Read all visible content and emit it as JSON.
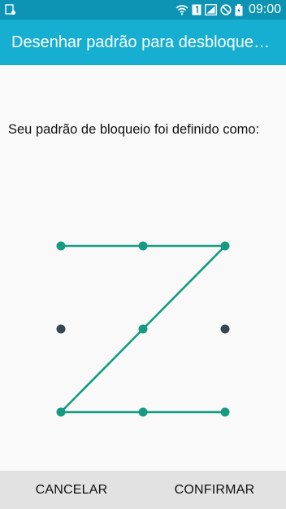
{
  "status_bar": {
    "time": "09:00",
    "icons": [
      "notification-icon",
      "wifi-icon",
      "sim1-icon",
      "signal-icon",
      "blocked-icon",
      "battery-charging-icon"
    ]
  },
  "app_bar": {
    "title": "Desenhar padrão para desbloquear a..."
  },
  "message": "Seu padrão de bloqueio foi definido como:",
  "pattern": {
    "grid": [
      3,
      3
    ],
    "sequence": [
      0,
      1,
      2,
      4,
      6,
      7,
      8
    ],
    "active_color": "#169b80",
    "inactive_color": "#37474f"
  },
  "buttons": {
    "cancel": "CANCELAR",
    "confirm": "CONFIRMAR"
  },
  "colors": {
    "status_bar": "#0d93b3",
    "app_bar": "#16aed1",
    "background": "#f9f9f9",
    "bottom_bar": "#e2e2e2"
  }
}
